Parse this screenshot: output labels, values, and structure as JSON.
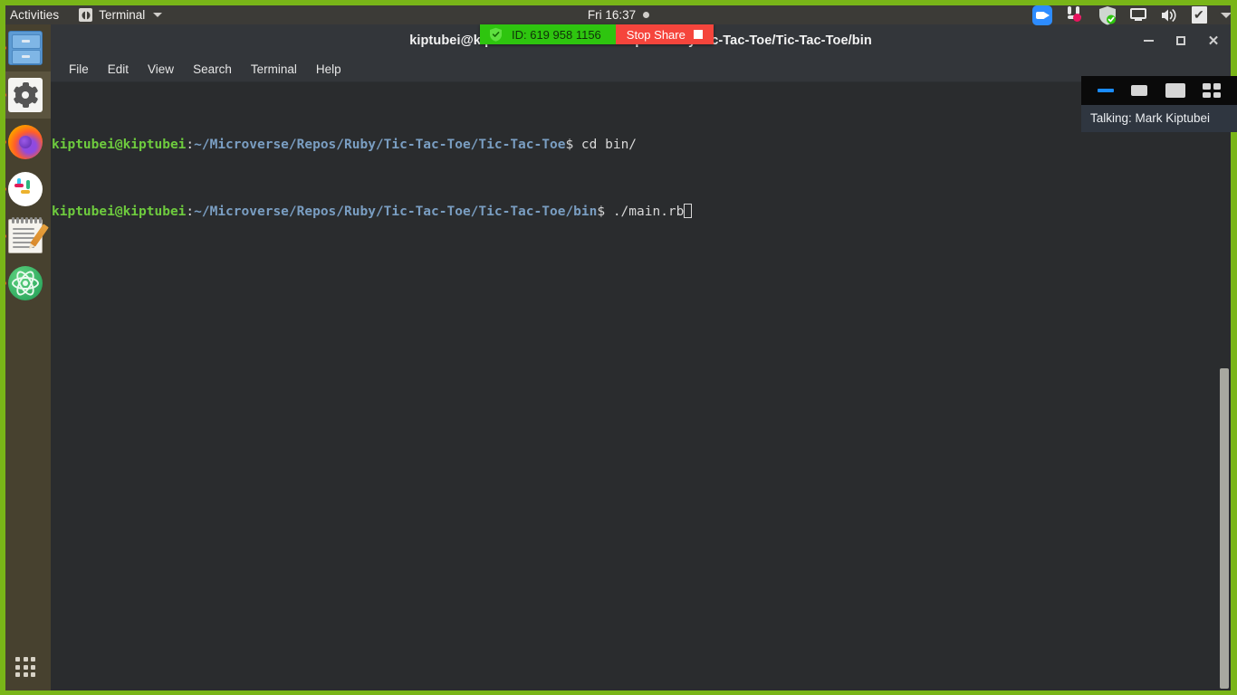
{
  "topbar": {
    "activities": "Activities",
    "app_menu": {
      "name": "Terminal",
      "icon": "terminal-app-icon"
    },
    "clock": "Fri 16:37",
    "tray": [
      {
        "name": "zoom-tray-icon",
        "label": "Zoom"
      },
      {
        "name": "slack-tray-icon",
        "label": "Slack"
      },
      {
        "name": "shield-tray-icon",
        "label": "Security"
      },
      {
        "name": "screencast-tray-icon",
        "label": "Screen sharing"
      },
      {
        "name": "volume-tray-icon",
        "label": "Volume"
      },
      {
        "name": "tasks-tray-icon",
        "label": "Tasks"
      },
      {
        "name": "system-menu-caret-icon",
        "label": "System menu"
      }
    ]
  },
  "dock": {
    "items": [
      {
        "label": "Files",
        "icon": "files-icon",
        "running": true,
        "active": false
      },
      {
        "label": "Settings",
        "icon": "settings-gear-icon",
        "running": true,
        "active": true
      },
      {
        "label": "Firefox",
        "icon": "firefox-icon",
        "running": true,
        "active": false
      },
      {
        "label": "Slack",
        "icon": "slack-icon",
        "running": true,
        "active": false
      },
      {
        "label": "Text Editor",
        "icon": "text-editor-icon",
        "running": true,
        "active": false
      },
      {
        "label": "Atom",
        "icon": "atom-icon",
        "running": true,
        "active": false
      }
    ],
    "show_applications": "Show Applications"
  },
  "terminal": {
    "title": "kiptubei@kiptubei: ~/Microverse/Repos/Ruby/Tic-Tac-Toe/Tic-Tac-Toe/bin",
    "menu": [
      "File",
      "Edit",
      "View",
      "Search",
      "Terminal",
      "Help"
    ],
    "window_buttons": {
      "minimize": "minimize",
      "maximize": "maximize",
      "close": "close"
    },
    "lines": [
      {
        "user": "kiptubei@kiptubei",
        "colon": ":",
        "path": "~/Microverse/Repos/Ruby/Tic-Tac-Toe/Tic-Tac-Toe",
        "prompt": "$",
        "command": " cd bin/",
        "cursor": false
      },
      {
        "user": "kiptubei@kiptubei",
        "colon": ":",
        "path": "~/Microverse/Repos/Ruby/Tic-Tac-Toe/Tic-Tac-Toe/bin",
        "prompt": "$",
        "command": " ./main.rb",
        "cursor": true
      }
    ]
  },
  "share_bar": {
    "meeting_id": "ID: 619 958 1156",
    "stop_share": "Stop Share",
    "shield_icon": "encryption-shield-icon",
    "stop_icon": "stop-square-icon"
  },
  "zoom_panel": {
    "view_buttons": [
      {
        "name": "minimize-video-button"
      },
      {
        "name": "small-video-button"
      },
      {
        "name": "large-video-button"
      },
      {
        "name": "gallery-view-button"
      }
    ],
    "talking": "Talking: Mark Kiptubei"
  },
  "colors": {
    "share_border_green": "#79b518",
    "share_pill_green": "#2ec50f",
    "stop_share_red": "#f5453c",
    "dock_background": "#47412f",
    "topbar_background": "#3c3b37",
    "terminal_background": "#2a2c2e",
    "prompt_user_green": "#6ecb3e",
    "prompt_path_blue": "#7a9ec2",
    "zoom_accent_blue": "#1a8cff"
  }
}
